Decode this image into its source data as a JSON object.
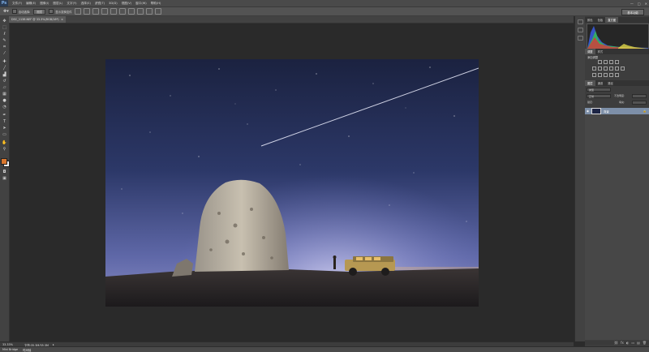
{
  "app": {
    "logo": "Ps",
    "menus": [
      "文件(F)",
      "编辑(E)",
      "图像(I)",
      "图层(L)",
      "文字(Y)",
      "选择(S)",
      "滤镜(T)",
      "3D(D)",
      "视图(V)",
      "窗口(W)",
      "帮助(H)"
    ],
    "window_controls": [
      "—",
      "□",
      "✕"
    ]
  },
  "options_bar": {
    "auto_select_label": "自动选择:",
    "auto_select_value": "图层",
    "show_transform_label": "显示变换控件",
    "workspace": "基本功能"
  },
  "document": {
    "tab_label": "DSC_1138.NEF @ 33.3%(RGB/16*)",
    "tab_close": "×"
  },
  "status": {
    "zoom": "33.33%",
    "doc_info": "文档:35.3M/35.3M",
    "mini_bridge": "Mini Bridge",
    "timeline": "时间轴"
  },
  "panels": {
    "top_tabs": [
      "颜色",
      "色板",
      "直方图"
    ],
    "adjust_tabs": [
      "调整",
      "样式"
    ],
    "adjust_title": "添加调整",
    "layer_tabs": [
      "图层",
      "通道",
      "路径"
    ],
    "blend_mode": "正常",
    "opacity_label": "不透明度:",
    "lock_label": "锁定:",
    "fill_label": "填充:",
    "filter_label": "类型",
    "layer_name": "背景",
    "footer_icons": [
      "fx",
      "◐",
      "▭",
      "▤",
      "🗑"
    ]
  },
  "colors": {
    "foreground": "#d9772e",
    "background": "#eeeeee",
    "layer_selected": "#7d8fa8"
  },
  "icons": {
    "toolbox": [
      "move-tool-icon",
      "marquee-tool-icon",
      "lasso-tool-icon",
      "quick-select-tool-icon",
      "crop-tool-icon",
      "eyedropper-tool-icon",
      "healing-brush-tool-icon",
      "brush-tool-icon",
      "clone-stamp-tool-icon",
      "history-brush-tool-icon",
      "eraser-tool-icon",
      "gradient-tool-icon",
      "blur-tool-icon",
      "dodge-tool-icon",
      "pen-tool-icon",
      "type-tool-icon",
      "path-select-tool-icon",
      "shape-tool-icon",
      "hand-tool-icon",
      "zoom-tool-icon"
    ]
  }
}
